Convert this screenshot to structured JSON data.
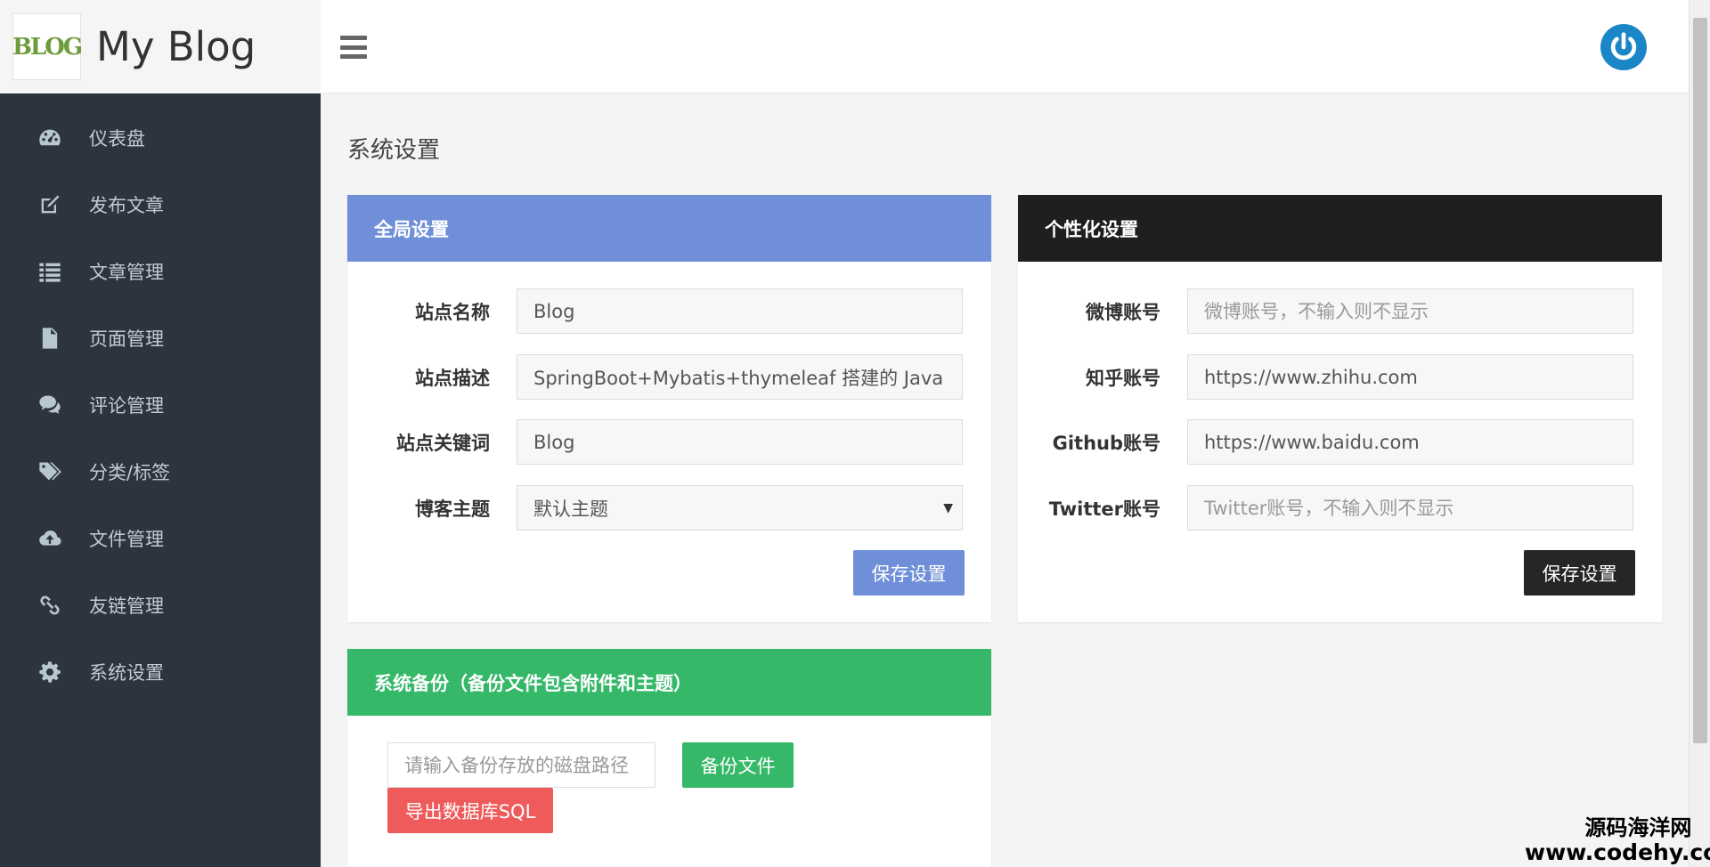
{
  "brand": {
    "title": "My Blog",
    "logo_text": "BLOG"
  },
  "sidebar": {
    "items": [
      {
        "label": "仪表盘",
        "icon": "dashboard-icon"
      },
      {
        "label": "发布文章",
        "icon": "edit-icon"
      },
      {
        "label": "文章管理",
        "icon": "list-icon"
      },
      {
        "label": "页面管理",
        "icon": "file-icon"
      },
      {
        "label": "评论管理",
        "icon": "comments-icon"
      },
      {
        "label": "分类/标签",
        "icon": "tags-icon"
      },
      {
        "label": "文件管理",
        "icon": "cloud-upload-icon"
      },
      {
        "label": "友链管理",
        "icon": "link-icon"
      },
      {
        "label": "系统设置",
        "icon": "gear-icon"
      }
    ]
  },
  "header": {
    "menu_icon": "hamburger-icon",
    "power_icon": "power-icon"
  },
  "page": {
    "title": "系统设置"
  },
  "global_settings": {
    "title": "全局设置",
    "color": "#6f8fd8",
    "site_name": {
      "label": "站点名称",
      "value": "Blog"
    },
    "site_desc": {
      "label": "站点描述",
      "value": "SpringBoot+Mybatis+thymeleaf 搭建的 Java 博"
    },
    "site_keywords": {
      "label": "站点关键词",
      "value": "Blog"
    },
    "blog_theme": {
      "label": "博客主题",
      "value": "默认主题"
    },
    "save_label": "保存设置"
  },
  "personal_settings": {
    "title": "个性化设置",
    "color": "#1f1f1f",
    "weibo": {
      "label": "微博账号",
      "value": "",
      "placeholder": "微博账号，不输入则不显示"
    },
    "zhihu": {
      "label": "知乎账号",
      "value": "https://www.zhihu.com"
    },
    "github": {
      "label": "Github账号",
      "value": "https://www.baidu.com"
    },
    "twitter": {
      "label": "Twitter账号",
      "value": "",
      "placeholder": "Twitter账号，不输入则不显示"
    },
    "save_label": "保存设置"
  },
  "backup": {
    "title": "系统备份（备份文件包含附件和主题）",
    "color": "#35b868",
    "path_placeholder": "请输入备份存放的磁盘路径",
    "backup_label": "备份文件",
    "export_label": "导出数据库SQL"
  },
  "watermark": {
    "line1": "源码海洋网",
    "line2": "www.codehy.com"
  }
}
